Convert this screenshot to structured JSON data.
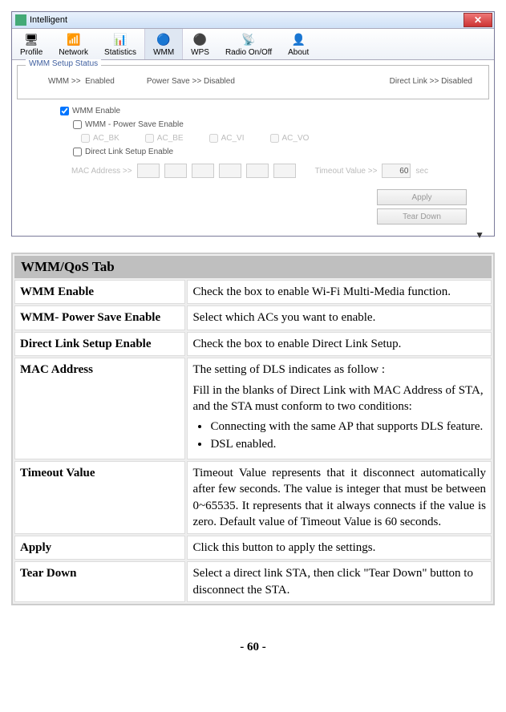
{
  "window": {
    "title": "Intelligent",
    "tabs": [
      "Profile",
      "Network",
      "Statistics",
      "WMM",
      "WPS",
      "Radio On/Off",
      "About"
    ],
    "status_group": "WMM Setup Status",
    "status": {
      "wmm_label": "WMM >>",
      "wmm_value": "Enabled",
      "ps_label": "Power Save >>",
      "ps_value": "Disabled",
      "dl_label": "Direct Link >>",
      "dl_value": "Disabled"
    },
    "checks": {
      "wmm_enable": "WMM Enable",
      "ps_enable": "WMM - Power Save Enable",
      "dl_enable": "Direct Link Setup Enable",
      "ac": [
        "AC_BK",
        "AC_BE",
        "AC_VI",
        "AC_VO"
      ]
    },
    "mac_label": "MAC Address >>",
    "timeout_label": "Timeout Value >>",
    "timeout_value": "60",
    "timeout_unit": "sec",
    "buttons": {
      "apply": "Apply",
      "teardown": "Tear Down"
    }
  },
  "desc": {
    "header": "WMM/QoS Tab",
    "rows": {
      "wmm_enable": {
        "k": "WMM Enable",
        "v": "Check the box to enable Wi-Fi Multi-Media function."
      },
      "ps_enable": {
        "k": "WMM- Power Save Enable",
        "v": "Select which ACs you want to enable."
      },
      "dl_enable": {
        "k": "Direct Link Setup Enable",
        "v": "Check the box to enable Direct Link Setup."
      },
      "mac": {
        "k": "MAC Address",
        "p1": "The setting of DLS indicates as follow :",
        "p2": "Fill in the blanks of Direct Link with MAC Address of STA, and the STA must conform to two conditions:",
        "b1": "Connecting with the same AP that supports DLS feature.",
        "b2": "DSL enabled."
      },
      "timeout": {
        "k": "Timeout Value",
        "v": "Timeout Value represents that it disconnect automatically after few seconds. The value is integer that must be between 0~65535. It represents that it always connects if the value is zero. Default value of Timeout Value is 60 seconds."
      },
      "apply": {
        "k": "Apply",
        "v": "Click this button to apply the settings."
      },
      "teardown": {
        "k": "Tear Down",
        "v": "Select a direct link STA, then click \"Tear Down\" button to disconnect the STA."
      }
    }
  },
  "page": "- 60 -"
}
